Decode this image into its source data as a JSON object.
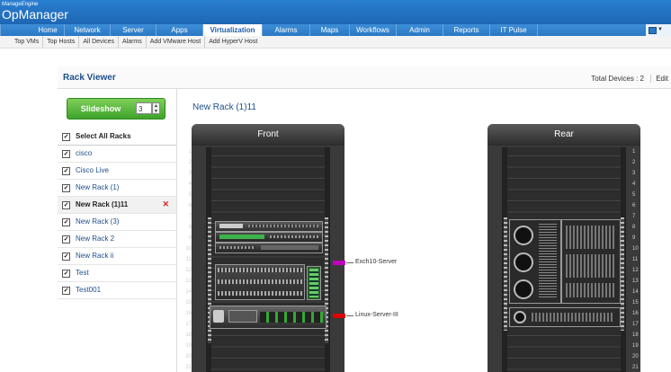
{
  "header": {
    "logo_small": "ManageEngine",
    "logo_big": "OpManager"
  },
  "nav": {
    "tabs": [
      {
        "label": "Home"
      },
      {
        "label": "Network"
      },
      {
        "label": "Server"
      },
      {
        "label": "Apps"
      },
      {
        "label": "Virtualization",
        "active": true
      },
      {
        "label": "Alarms"
      },
      {
        "label": "Maps"
      },
      {
        "label": "Workflows"
      },
      {
        "label": "Admin"
      },
      {
        "label": "Reports"
      },
      {
        "label": "IT Pulse"
      }
    ]
  },
  "subnav": {
    "items": [
      "Top VMs",
      "Top Hosts",
      "All Devices",
      "Alarms",
      "Add VMware Host",
      "Add HyperV Host"
    ]
  },
  "panel": {
    "title": "Rack Viewer",
    "total_devices": "Total Devices : 2",
    "edit": "Edit"
  },
  "sidebar": {
    "slideshow_label": "Slideshow",
    "slideshow_value": "3",
    "select_all": "Select All Racks",
    "racks": [
      {
        "name": "cisco",
        "checked": true
      },
      {
        "name": "Cisco Live",
        "checked": true
      },
      {
        "name": "New Rack (1)",
        "checked": true
      },
      {
        "name": "New Rack (1)11",
        "checked": true,
        "selected": true
      },
      {
        "name": "New Rack (3)",
        "checked": true
      },
      {
        "name": "New Rack 2",
        "checked": true
      },
      {
        "name": "New Rack ii",
        "checked": true
      },
      {
        "name": "Test",
        "checked": true
      },
      {
        "name": "Test001",
        "checked": true
      }
    ]
  },
  "content": {
    "rack_title": "New Rack (1)11",
    "front_label": "Front",
    "rear_label": "Rear",
    "unit_numbers": [
      "1",
      "2",
      "3",
      "4",
      "5",
      "6",
      "7",
      "8",
      "9",
      "10",
      "11",
      "12",
      "13",
      "14",
      "15",
      "16",
      "17",
      "18",
      "19",
      "20",
      "21"
    ],
    "devices": [
      {
        "name": "Exch10-Server",
        "marker_color": "#c000c0"
      },
      {
        "name": "Linux-Server-III",
        "marker_color": "#e00000"
      }
    ]
  }
}
